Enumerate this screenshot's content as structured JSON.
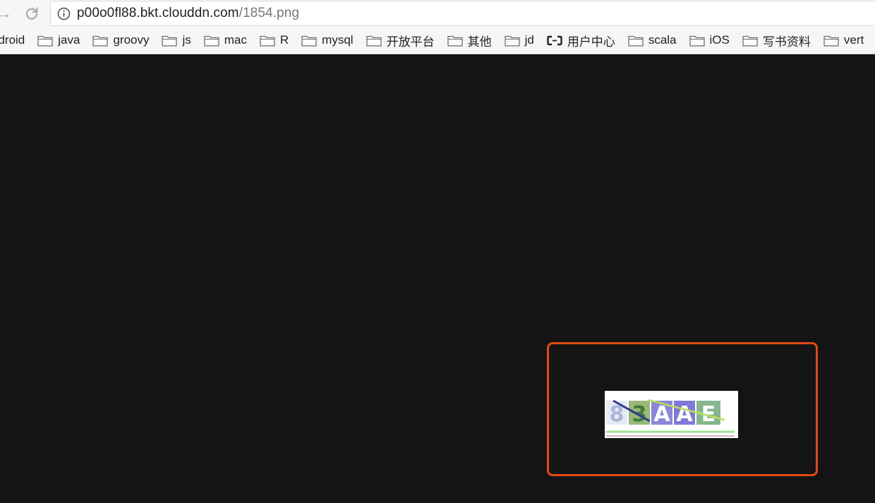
{
  "browser": {
    "url_host": "p00o0fl88.bkt.clouddn.com",
    "url_path": "/1854.png",
    "icons": {
      "forward": "arrow-right-icon",
      "reload": "reload-icon",
      "info": "info-icon",
      "folder": "folder-icon",
      "bookmark_special": "aliyun-logo-icon"
    }
  },
  "bookmarks": [
    {
      "label": "ndroid",
      "icon": "none"
    },
    {
      "label": "java",
      "icon": "folder-icon"
    },
    {
      "label": "groovy",
      "icon": "folder-icon"
    },
    {
      "label": "js",
      "icon": "folder-icon"
    },
    {
      "label": "mac",
      "icon": "folder-icon"
    },
    {
      "label": "R",
      "icon": "folder-icon"
    },
    {
      "label": "mysql",
      "icon": "folder-icon"
    },
    {
      "label": "开放平台",
      "icon": "folder-icon"
    },
    {
      "label": "其他",
      "icon": "folder-icon"
    },
    {
      "label": "jd",
      "icon": "folder-icon"
    },
    {
      "label": "用户中心",
      "icon": "aliyun-logo-icon"
    },
    {
      "label": "scala",
      "icon": "folder-icon"
    },
    {
      "label": "iOS",
      "icon": "folder-icon"
    },
    {
      "label": "写书资料",
      "icon": "folder-icon"
    },
    {
      "label": "vert",
      "icon": "folder-icon"
    }
  ],
  "content": {
    "background": "#141414",
    "highlight_color": "#e04a12",
    "captcha": {
      "characters": [
        "8",
        "3",
        "A",
        "A",
        "E"
      ],
      "tile_colors": [
        "#e6eaf6",
        "#9ab878",
        "#8b86d8",
        "#8278d6",
        "#86b690"
      ],
      "char_colors": [
        "#a9b7d8",
        "#3f7a3a",
        "#ffffff",
        "#ffffff",
        "#ffffff"
      ]
    }
  }
}
